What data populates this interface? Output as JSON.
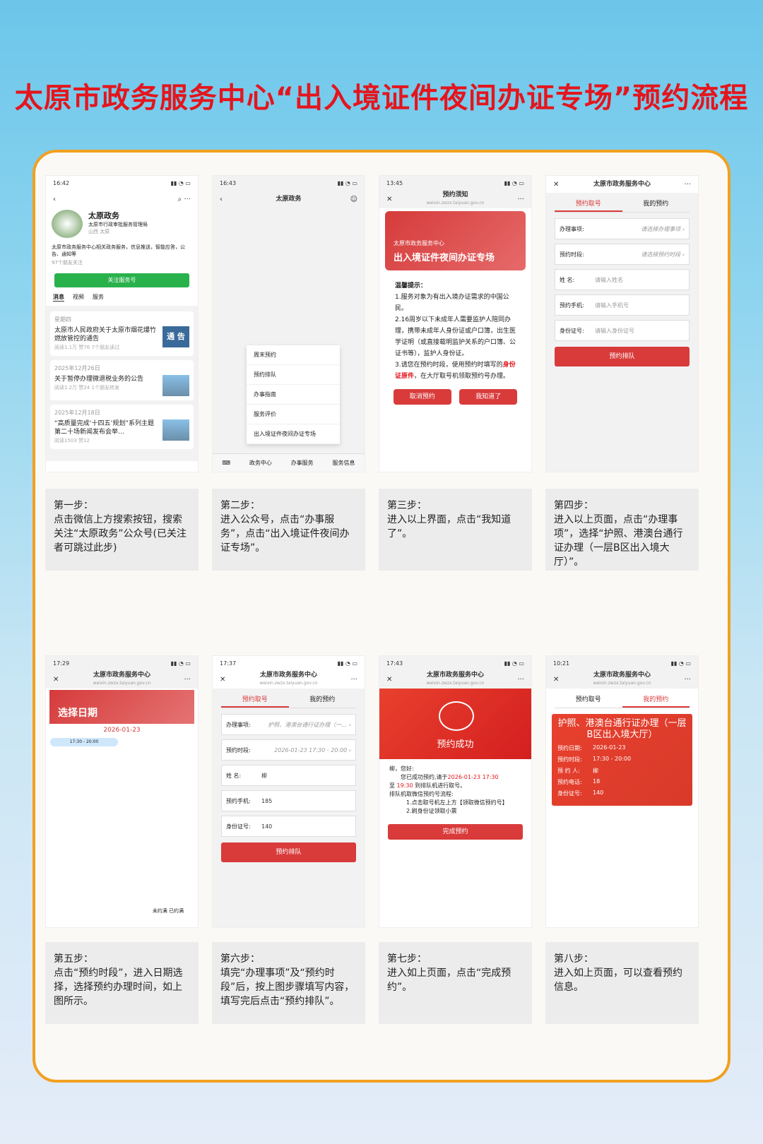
{
  "title": "太原市政务服务中心“出入境证件夜间办证专场”预约流程",
  "s1": {
    "time": "16:42",
    "name": "太原政务",
    "org": "太原市行政审批服务管理局",
    "loc": "山西 太原",
    "desc": "太原市政务服务中心相关政务服务，信息推送，智能应答，公告、通知等",
    "friends": "97个朋友关注",
    "follow": "关注服务号",
    "tabs": [
      "消息",
      "视频",
      "服务"
    ],
    "day": "星期四",
    "a1": "太原市人民政府关于太原市烟花爆竹燃放管控的通告",
    "a1m": "阅读1.1万  赞76  7个朋友读过",
    "a1t": "通 告",
    "d2": "2025年12月26日",
    "a2": "关于暂停办理微退税业务的公告",
    "a2m": "阅读1.2万  赞24  1个朋友转发",
    "d3": "2025年12月18日",
    "a3": "“高质量完成‘十四五’规划”系列主题第二十场新闻发布会举…",
    "a3m": "阅读1503  赞12"
  },
  "s2": {
    "time": "16:43",
    "nav": "太原政务",
    "menu": [
      "周末预约",
      "预约排队",
      "办事指南",
      "服务评价",
      "出入境证件夜间办证专场"
    ],
    "bnav": [
      "政务中心",
      "办事服务",
      "服务信息"
    ]
  },
  "s3": {
    "time": "13:45",
    "nav": "预约须知",
    "url": "weixin.zwzx.taiyuan.gov.cn",
    "bs": "太原市政务服务中心",
    "bb": "出入境证件夜间办证专场",
    "tip": "温馨提示：",
    "p1": "1.服务对象为有出入境办证需求的中国公民。",
    "p2": "2.16周岁以下未成年人需要监护人陪同办理，携带未成年人身份证或户口簿，出生医学证明（或直接载明监护关系的户口簿、公证书等），监护人身份证。",
    "p3a": "3.请您在预约时段，使用预约时填写的",
    "p3b": "身份证原件",
    "p3c": "，在大厅取号机领取预约号办理。",
    "cancel": "取消预约",
    "ok": "我知道了"
  },
  "s4": {
    "nav": "太原市政务服务中心",
    "t1": "预约取号",
    "t2": "我的预约",
    "f": [
      {
        "l": "办理事项:",
        "v": "请选择办理事项 ›"
      },
      {
        "l": "预约时段:",
        "v": "请选择预约时段 ›"
      },
      {
        "l": "姓 名:",
        "v": "请输入姓名"
      },
      {
        "l": "预约手机:",
        "v": "请输入手机号"
      },
      {
        "l": "身份证号:",
        "v": "请输入身份证号"
      }
    ],
    "btn": "预约排队"
  },
  "s5": {
    "time": "17:29",
    "nav": "太原市政务服务中心",
    "url": "weixin.zwzx.taiyuan.gov.cn",
    "ban": "选择日期",
    "date": "2026-01-23",
    "slot": "17:30 - 20:00",
    "legend": "未约满  已约满"
  },
  "s6": {
    "time": "17:37",
    "nav": "太原市政务服务中心",
    "url": "weixin.zwzx.taiyuan.gov.cn",
    "t1": "预约取号",
    "t2": "我的预约",
    "f": [
      {
        "l": "办理事项:",
        "v": "护照、港澳台通行证办理（一… ›"
      },
      {
        "l": "预约时段:",
        "v": "2026-01-23 17:30 - 20:00 ›"
      },
      {
        "l": "姓 名:",
        "v": "柳"
      },
      {
        "l": "预约手机:",
        "v": "185"
      },
      {
        "l": "身份证号:",
        "v": "140"
      }
    ],
    "btn": "预约排队"
  },
  "s7": {
    "time": "17:43",
    "nav": "太原市政务服务中心",
    "url": "weixin.zwzx.taiyuan.gov.cn",
    "succ": "预约成功",
    "hi": "柳，您好:",
    "l1a": "您已成功预约,请于",
    "l1b": "2026-01-23 17:30",
    "l2a": "至",
    "l2b": "19:30",
    "l2c": "到排队机进行取号。",
    "flow": "排队机取微信预约号流程:",
    "f1": "1.点击取号机左上方【领取微信预约号】",
    "f2": "2.刷身份证领取小票",
    "btn": "完成预约"
  },
  "s8": {
    "time": "10:21",
    "nav": "太原市政务服务中心",
    "url": "weixin.zwzx.taiyuan.gov.cn",
    "t1": "预约取号",
    "t2": "我的预约",
    "head": "护照、港澳台通行证办理（一层B区出入境大厅）",
    "rows": [
      {
        "k": "预约日期:",
        "v": "2026-01-23"
      },
      {
        "k": "预约时段:",
        "v": "17:30 - 20:00"
      },
      {
        "k": "预 约 人:",
        "v": "柳"
      },
      {
        "k": "预约电话:",
        "v": "18"
      },
      {
        "k": "身份证号:",
        "v": "140"
      }
    ]
  },
  "caps": [
    "第一步：\n点击微信上方搜索按钮，搜索关注“太原政务”公众号(已关注者可跳过此步)",
    "第二步：\n进入公众号，点击“办事服务”，点击“出入境证件夜间办证专场”。",
    "第三步：\n进入以上界面，点击“我知道了”。",
    "第四步：\n进入以上页面，点击“办理事项”，选择“护照、港澳台通行证办理（一层B区出入境大厅）”。",
    "第五步：\n点击“预约时段”，进入日期选择，选择预约办理时间，如上图所示。",
    "第六步：\n填完“办理事项”及“预约时段”后，按上图步骤填写内容，填写完后点击“预约排队”。",
    "第七步：\n进入如上页面，点击“完成预约”。",
    "第八步：\n进入如上页面，可以查看预约信息。"
  ]
}
